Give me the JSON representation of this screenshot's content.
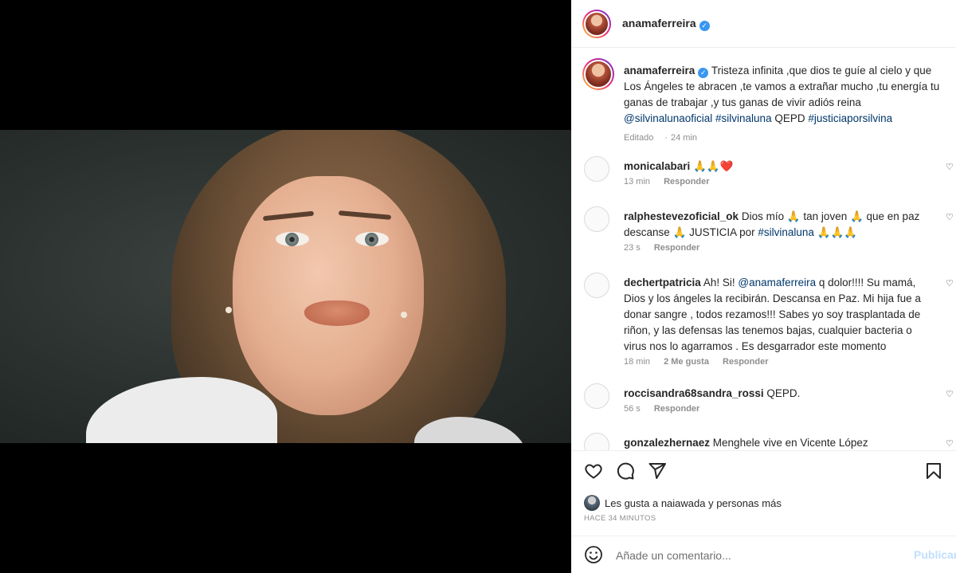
{
  "post": {
    "author": "anamaferreira",
    "caption_parts": {
      "text": "Tristeza infinita ,que dios te guíe al cielo y que Los Ángeles te abracen ,te vamos a extrañar mucho ,tu energía tu ganas de trabajar ,y tus ganas de vivir adiós reina",
      "mention": "@silvinalunaoficial",
      "tag1": "#silvinaluna",
      "qepd": "QEPD",
      "tag2": "#justiciaporsilvina"
    },
    "edited": "Editado",
    "edited_time": "24 min"
  },
  "comments": [
    {
      "user": "monicalabari",
      "text": "🙏🙏❤️",
      "time": "13 min",
      "likes": "",
      "reply": "Responder"
    },
    {
      "user": "ralphestevezoficial_ok",
      "text": "Dios mío 🙏 tan joven 🙏 que en paz descanse 🙏 JUSTICIA por",
      "tag": "#silvinaluna",
      "text2": "🙏🙏🙏",
      "time": "23 s",
      "likes": "",
      "reply": "Responder"
    },
    {
      "user": "dechertpatricia",
      "text": "Ah! Si!",
      "tag": "@anamaferreira",
      "text2": "q dolor!!!! Su mamá, Dios y los ángeles la recibirán. Descansa en Paz. Mi hija fue a donar sangre , todos rezamos!!! Sabes yo soy trasplantada de riñon, y las defensas las tenemos bajas, cualquier bacteria o virus nos lo agarramos . Es desgarrador este momento",
      "time": "18 min",
      "likes": "2 Me gusta",
      "reply": "Responder"
    },
    {
      "user": "roccisandra68sandra_rossi",
      "text": "QEPD.",
      "time": "56 s",
      "likes": "",
      "reply": "Responder"
    },
    {
      "user": "gonzalezhernaez",
      "text": "Menghele vive en Vicente López"
    }
  ],
  "likes_text": "Les gusta a naiawada y personas más",
  "posted_time": "HACE 34 MINUTOS",
  "add_comment": {
    "placeholder": "Añade un comentario...",
    "post_label": "Publicar"
  },
  "icons": [
    "heart-icon",
    "comment-icon",
    "share-icon",
    "bookmark-icon",
    "emoji-icon",
    "verified-icon"
  ],
  "colors": {
    "verified": "#3897f0",
    "tag": "#00376b",
    "muted": "#8e8e8e",
    "post_disabled": "#c0dffd"
  }
}
